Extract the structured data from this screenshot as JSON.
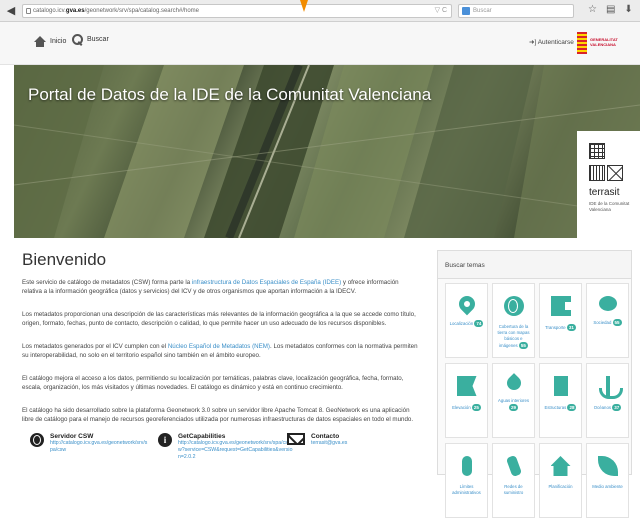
{
  "browser": {
    "url_prefix": "catalogo.icv.",
    "url_domain": "gva.es",
    "url_rest": "/geonetwork/srv/spa/catalog.search#/home",
    "url_right": "▽ C",
    "search_placeholder": "Buscar",
    "back_glyph": "◀",
    "icons": [
      "star-icon",
      "bookmark-icon",
      "download-icon",
      "home-icon"
    ]
  },
  "header": {
    "home_label": "Inicio",
    "search_label": "Buscar",
    "auth_label": "Autenticarse",
    "logo_text": "GENERALITAT VALENCIANA"
  },
  "hero": {
    "title": "Portal de Datos de la IDE de la Comunitat Valenciana",
    "brand_name": "terrasit",
    "brand_sub": "IDE de la Comunitat Valenciana"
  },
  "main": {
    "heading": "Bienvenido",
    "p1_a": "Este servicio de catálogo de metadatos (CSW) forma parte la ",
    "p1_link": "infraestructura de Datos Espaciales de España (IDEE)",
    "p1_b": " y ofrece información relativa a la información geográfica (datos y servicios) del ICV y de otros organismos que aportan información a la IDECV.",
    "p2": "Los metadatos proporcionan una descripción de las características más relevantes de la información geográfica a la que se accede como título, origen, formato, fechas, punto de contacto, descripción o calidad, lo que permite hacer un uso adecuado de los recursos disponibles.",
    "p3_a": "Los metadatos generados por el ICV cumplen con el ",
    "p3_link": "Núcleo Español de Metadatos (NEM)",
    "p3_b": ". Los metadatos conformes con la normativa permiten su interoperabilidad, no solo en el territorio español sino también en el ámbito europeo.",
    "p4": "El catálogo mejora el acceso a los datos, permitiendo su localización por temáticas, palabras clave, localización geográfica, fecha, formato, escala, organización, los más visitados y últimas novedades. El catálogo es dinámico y está en continuo crecimiento.",
    "p5": "El catálogo ha sido desarrollado sobre la plataforma Geonetwork 3.0 sobre un servidor libre Apache Tomcat 8. GeoNetwork es una aplicación libre de catálogo para el manejo de recursos georeferenciados utilizada por numerosas infraestructuras de datos espaciales en todo el mundo."
  },
  "contacts": [
    {
      "title": "Servidor CSW",
      "text": "http://catalogo.icv.gva.es/geonetwork/srv/spa/csw"
    },
    {
      "title": "GetCapabilities",
      "text": "http://catalogo.icv.gva.es/geonetwork/srv/spa/csw?service=CSW&request=GetCapabilities&version=2.0.2"
    },
    {
      "title": "Contacto",
      "text": "terrasit@gva.es"
    }
  ],
  "topics": {
    "header": "Buscar temas",
    "accent": "#3aaf9f",
    "items": [
      {
        "label": "Localización",
        "count": "74",
        "icon": "map-pin-icon"
      },
      {
        "label": "Cobertura de la tierra con mapas básicos e imágenes",
        "count": "55",
        "icon": "globe-icon"
      },
      {
        "label": "Transporte",
        "count": "31",
        "icon": "truck-icon"
      },
      {
        "label": "Sociedad",
        "count": "55",
        "icon": "chat-icon"
      },
      {
        "label": "Elevación",
        "count": "25",
        "icon": "flag-icon"
      },
      {
        "label": "Aguas interiores",
        "count": "29",
        "icon": "water-drop-icon"
      },
      {
        "label": "Estructuras",
        "count": "28",
        "icon": "building-icon"
      },
      {
        "label": "Océanos",
        "count": "37",
        "icon": "anchor-icon"
      },
      {
        "label": "Límites administrativos",
        "count": "",
        "icon": "microphone-icon"
      },
      {
        "label": "Redes de suministro",
        "count": "",
        "icon": "phone-icon"
      },
      {
        "label": "Planificación",
        "count": "",
        "icon": "house-icon"
      },
      {
        "label": "Medio ambiente",
        "count": "",
        "icon": "leaf-icon"
      }
    ]
  }
}
